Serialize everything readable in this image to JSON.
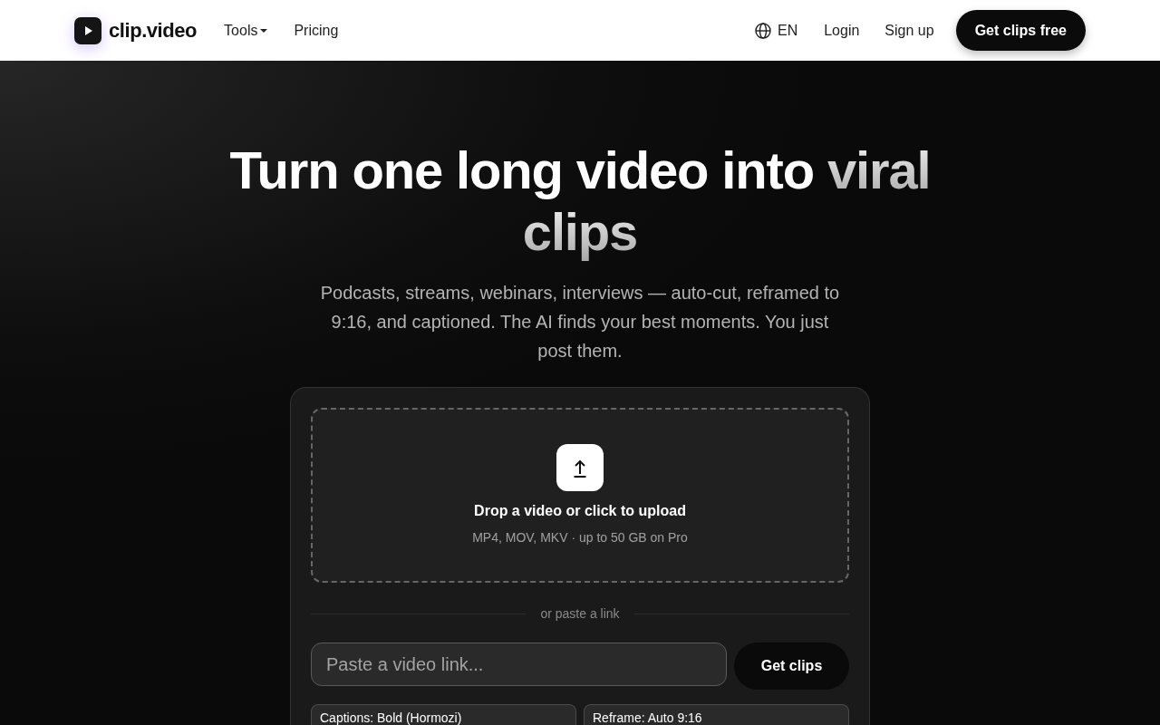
{
  "header": {
    "logo": {
      "text": "clip.video"
    },
    "nav": [
      {
        "label": "Tools",
        "kind": "dropdown"
      },
      {
        "label": "Pricing",
        "kind": "link"
      }
    ],
    "language": "EN",
    "login": "Login",
    "signup": "Sign up",
    "cta": "Get clips free"
  },
  "hero": {
    "title": "Turn one long video into",
    "title_highlight": "viral clips",
    "subtitle": "Podcasts, streams, webinars, interviews — auto-cut, reframed to 9:16, and captioned. The AI finds your best moments. You just post them."
  },
  "upload": {
    "dropzone": {
      "title": "Drop a video or click to upload",
      "hint": "MP4, MOV, MKV · up to 50 GB on Pro"
    },
    "divider": "or paste a link",
    "link_field": {
      "placeholder": "Paste a video link..."
    },
    "submit": "Get clips",
    "options": [
      {
        "label": "Captions: Bold (Hormozi)"
      },
      {
        "label": "Reframe: Auto 9:16"
      }
    ]
  }
}
